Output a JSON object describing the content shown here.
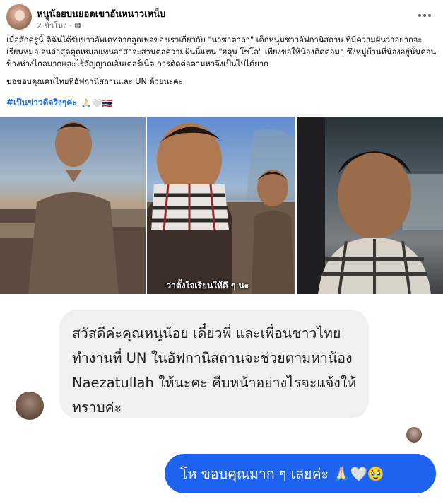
{
  "post": {
    "author": "หนูน้อยบนยอดเขาอันหนาวเหน็บ",
    "time": "2 ชั่วโมง ·",
    "privacy_icon": "globe-icon",
    "more_icon": "more-options-icon",
    "paragraph_1": "เมื่อสักครู่นี้ ดิฉันได้รับข่าวอัพเดทจากลูกเพจของเราเกี่ยวกับ \"นาซาตาลา\" เด็กหนุ่มชาวอัฟกานิสถาน ที่มีความฝันว่าอยากจะเรียนหมอ จนล่าสุดคุณหมอแทนอาสาจะสานต่อความฝันนี้แทน \"ฮลุน โซโล\" เพียงขอให้น้องติดต่อมา ซึ่งหมู่บ้านที่น้องอยู่นั้นค่อนข้างห่างไกลมากและไร้สัญญาณอินเตอร์เน็ต การติดต่อตามหาจึงเป็นไปได้ยาก",
    "paragraph_2": "ขอขอบคุณคนไทยที่อัฟกานิสถานและ UN ด้วยนะคะ",
    "hashtag": "#เป็นข่าวดีจริงๆค่ะ",
    "hashtag_emojis": "🙏🏻🤍🇹🇭"
  },
  "photos": {
    "caption": "ว่าตั้งใจเรียนให้ดี ๆ นะ"
  },
  "chat": {
    "incoming_message": "สวัสดีค่ะคุณหนูน้อย เดี๋ยวพี่ และเพื่อนชาวไทย ทำงานที่ UN ในอัฟกานิสถานจะช่วยตามหาน้อง Naezatullah ให้นะคะ คืบหน้าอย่างไรจะแจ้งให้ทราบค่ะ",
    "outgoing_message": "โห ขอบคุณมาก ๆ เลยค่ะ 🙏🏻🤍🥹"
  }
}
